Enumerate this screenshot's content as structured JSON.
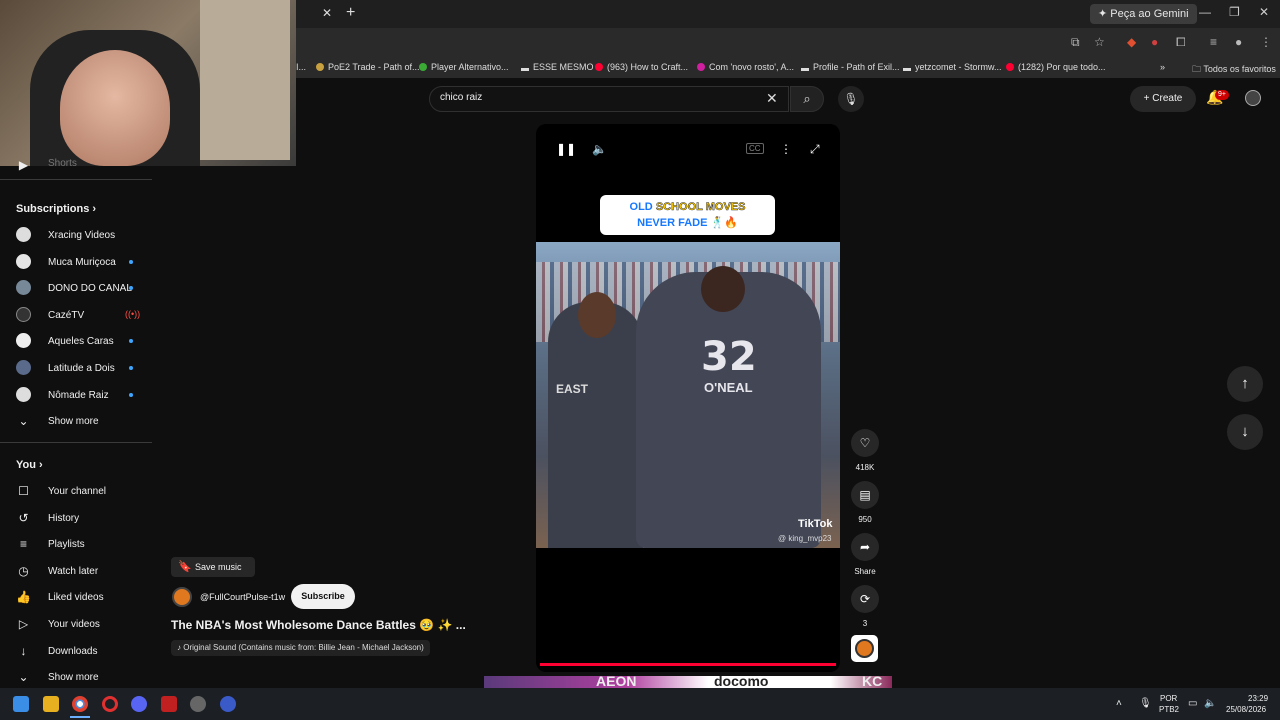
{
  "browser": {
    "gemini_label": "Peça ao Gemini",
    "bookmarks": [
      {
        "label": "I...",
        "color": "#888888"
      },
      {
        "label": "PoE2 Trade - Path of...",
        "color": "#c8a040"
      },
      {
        "label": "Player Alternativo...",
        "color": "#3aaa35"
      },
      {
        "label": "ESSE MESMO",
        "color": "#dddddd"
      },
      {
        "label": "(963) How to Craft...",
        "color": "#ff0033"
      },
      {
        "label": "Com 'novo rosto', A...",
        "color": "#d020a0"
      },
      {
        "label": "Profile - Path of Exil...",
        "color": "#dddddd"
      },
      {
        "label": "yetzcomet - Stormw...",
        "color": "#dddddd"
      },
      {
        "label": "(1282) Por que todo...",
        "color": "#ff0033"
      }
    ],
    "all_bookmarks_label": "Todos os favoritos"
  },
  "header": {
    "search_value": "chico raiz",
    "create_label": "Create",
    "notification_badge": "9+"
  },
  "sidebar": {
    "shorts_label": "Shorts",
    "subscriptions_heading": "Subscriptions",
    "subscriptions": [
      {
        "label": "Xracing Videos",
        "new": false,
        "avatar_color": "#dddddd"
      },
      {
        "label": "Muca Muriçoca",
        "new": true,
        "avatar_color": "#e6e6e6"
      },
      {
        "label": "DONO DO CANAL",
        "new": true,
        "avatar_color": "#778899"
      },
      {
        "label": "CazéTV",
        "new": false,
        "live": true,
        "avatar_color": "#333333"
      },
      {
        "label": "Aqueles Caras",
        "new": true,
        "avatar_color": "#eeeeee"
      },
      {
        "label": "Latitude a Dois",
        "new": true,
        "avatar_color": "#5a6a8a"
      },
      {
        "label": "Nômade Raiz",
        "new": true,
        "avatar_color": "#dddddd"
      }
    ],
    "show_more_label": "Show more",
    "you_heading": "You",
    "you_items": [
      {
        "label": "Your channel",
        "icon": "channel-icon"
      },
      {
        "label": "History",
        "icon": "history-icon"
      },
      {
        "label": "Playlists",
        "icon": "playlists-icon"
      },
      {
        "label": "Watch later",
        "icon": "watch-later-icon"
      },
      {
        "label": "Liked videos",
        "icon": "like-icon"
      },
      {
        "label": "Your videos",
        "icon": "your-videos-icon"
      },
      {
        "label": "Downloads",
        "icon": "download-icon"
      }
    ],
    "show_more_2_label": "Show more"
  },
  "video": {
    "caption_line1_a": "OLD",
    "caption_line1_b": "SCHOOL MOVES",
    "caption_line2": "NEVER FADE 🕺🔥",
    "jersey_number": "32",
    "jersey_name": "O'NEAL",
    "jersey_team": "EAST",
    "watermark": "TikTok",
    "watermark_user": "@ king_mvp23",
    "progress": 1.0,
    "save_music_label": "Save music",
    "channel": "@FullCourtPulse-t1w",
    "subscribe_label": "Subscribe",
    "title": "The NBA's Most Wholesome Dance Battles 🥹 ✨ ...",
    "sound": "Original Sound (Contains music from: Billie Jean - Michael Jackson)"
  },
  "actions": {
    "likes": "418K",
    "comments": "950",
    "share": "Share",
    "remix": "3"
  },
  "next_preview": {
    "text1": "AEON",
    "text2": "docomo",
    "text3": "KC"
  },
  "taskbar": {
    "lang": "POR",
    "layout": "PTB2",
    "time": "23:29",
    "date": "25/08/2026"
  }
}
